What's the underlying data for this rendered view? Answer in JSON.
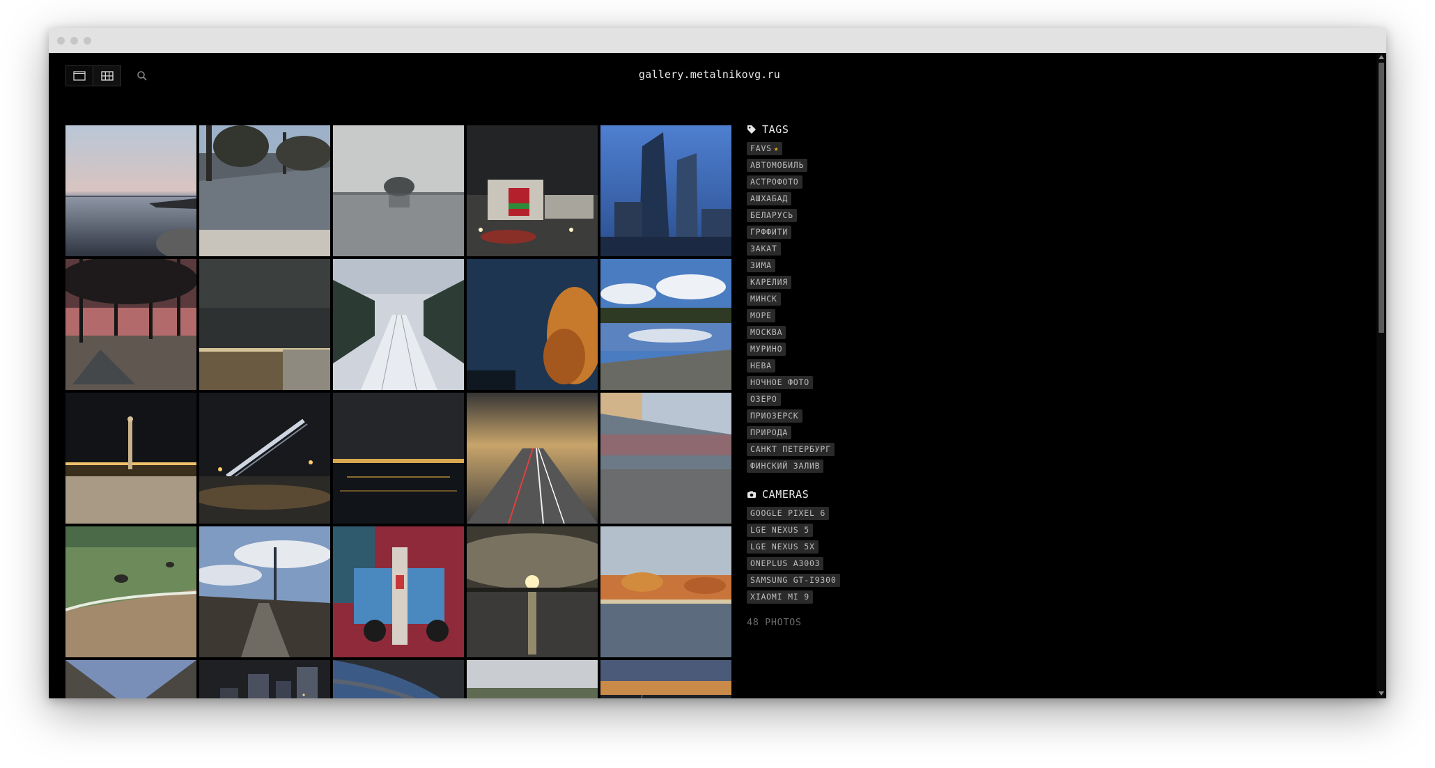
{
  "window": {
    "title_dots": [
      "close",
      "minimize",
      "maximize"
    ]
  },
  "header": {
    "site_title": "gallery.metalnikovg.ru",
    "view_modes": [
      "single-view",
      "grid-view"
    ],
    "search_icon": "search-icon"
  },
  "gallery": {
    "photos": [
      {
        "subject": "calm lake at dusk with pier"
      },
      {
        "subject": "flooded path with trees"
      },
      {
        "subject": "misty lake with small island"
      },
      {
        "subject": "night city square with illuminated building"
      },
      {
        "subject": "skyscrapers at blue hour"
      },
      {
        "subject": "tent under pine trees at sunset"
      },
      {
        "subject": "night sky over fence"
      },
      {
        "subject": "snowy railway through forest"
      },
      {
        "subject": "autumn tree under starry sky"
      },
      {
        "subject": "lake reflecting clouds"
      },
      {
        "subject": "column on palace square at night"
      },
      {
        "subject": "raised drawbridge at night"
      },
      {
        "subject": "river embankment lights at night"
      },
      {
        "subject": "highway light trails at sunset"
      },
      {
        "subject": "moving train on platform"
      },
      {
        "subject": "green sea shore with stones"
      },
      {
        "subject": "path towards tall tower"
      },
      {
        "subject": "painted truck exhibit"
      },
      {
        "subject": "sunset over river"
      },
      {
        "subject": "autumn trees along river"
      },
      {
        "subject": "under bridge perspective"
      },
      {
        "subject": "night skyscrapers"
      },
      {
        "subject": "bridge underside at dusk"
      },
      {
        "subject": "forest landscape"
      },
      {
        "subject": "railway at sunset"
      }
    ]
  },
  "sidebar": {
    "tags_heading": "TAGS",
    "tags": [
      "FAVS",
      "АВТОМОБИЛЬ",
      "АСТРОФОТО",
      "АШХАБАД",
      "БЕЛАРУСЬ",
      "ГРФФИТИ",
      "ЗАКАТ",
      "ЗИМА",
      "КАРЕЛИЯ",
      "МИНСК",
      "МОРЕ",
      "МОСКВА",
      "МУРИНО",
      "НЕВА",
      "НОЧНОЕ ФОТО",
      "ОЗЕРО",
      "ПРИОЗЕРСК",
      "ПРИРОДА",
      "САНКТ ПЕТЕРБУРГ",
      "ФИНСКИЙ ЗАЛИВ"
    ],
    "favs_star": "★",
    "cameras_heading": "CAMERAS",
    "cameras": [
      "GOOGLE PIXEL 6",
      "LGE NEXUS 5",
      "LGE NEXUS 5X",
      "ONEPLUS A3003",
      "SAMSUNG GT-I9300",
      "XIAOMI MI 9"
    ],
    "photo_count": "48 PHOTOS"
  },
  "colors": {
    "background": "#000000",
    "tag_bg": "#2a2a2a",
    "tag_text": "#bdbdbd",
    "star": "#e8a321",
    "muted": "#6d6d6d"
  }
}
